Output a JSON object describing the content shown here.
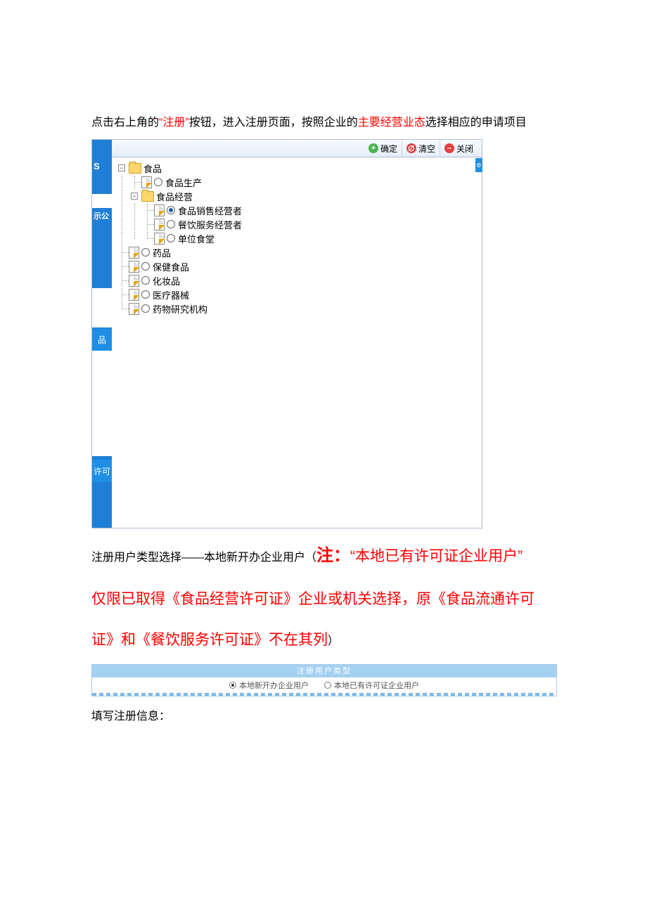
{
  "para1": {
    "pre": "点击右上角的",
    "quote": "“注册”",
    "mid": "按钮，进入注册页面，按照企业的",
    "key": "主要经营业态",
    "post": "选择相应的申请项目"
  },
  "toolbar": {
    "ok": "确定",
    "clear": "清空",
    "close": "关闭"
  },
  "tree": {
    "n_food": "食品",
    "n_food_prod": "食品生产",
    "n_food_biz": "食品经营",
    "n_sales_op": "食品销售经营者",
    "n_catering_op": "餐饮服务经营者",
    "n_canteen": "单位食堂",
    "n_drug": "药品",
    "n_health": "保健食品",
    "n_cosmetic": "化妆品",
    "n_med_device": "医疗器械",
    "n_drug_research": "药物研究机构"
  },
  "left_strip": {
    "sh": "S",
    "gong": "示公",
    "pin": "品",
    "ke": "许可"
  },
  "right_tab": "e",
  "para2": {
    "pre": "注册用户类型选择——本地新开办企业用户（",
    "note_label": "注：",
    "line1": "“本地已有许可证企业用户”",
    "line2": "仅限已取得《食品经营许可证》企业或机关选择，原《食品流通许可",
    "line3": "证》和《餐饮服务许可证》不在其列",
    "post": "）"
  },
  "user_type": {
    "header": "注册用户类型",
    "opt1": "本地新开办企业用户",
    "opt2": "本地已有许可证企业用户"
  },
  "para3": "填写注册信息："
}
